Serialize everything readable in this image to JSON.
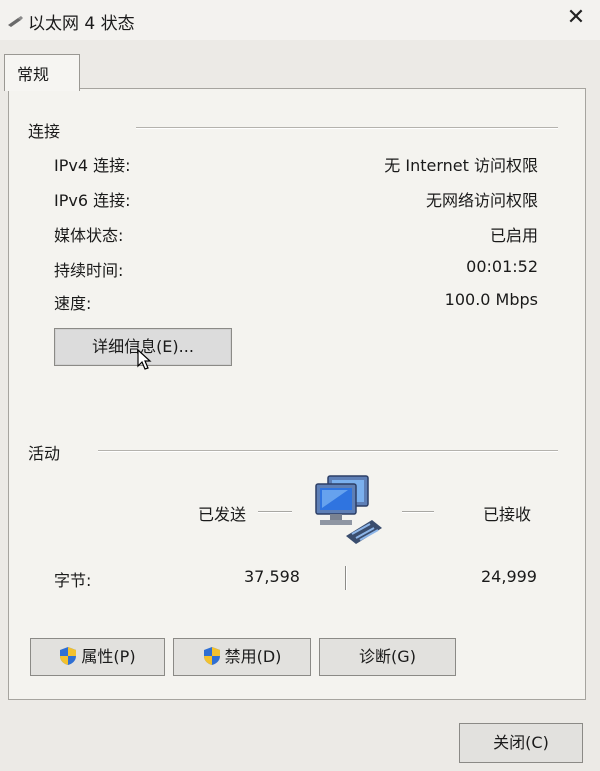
{
  "window": {
    "title": "以太网 4 状态",
    "icon": "network-adapter-icon",
    "close_glyph": "✕"
  },
  "tabs": [
    {
      "label": "常规",
      "selected": true
    }
  ],
  "connection": {
    "group_label": "连接",
    "rows": [
      {
        "label": "IPv4 连接:",
        "value": "无 Internet 访问权限"
      },
      {
        "label": "IPv6 连接:",
        "value": "无网络访问权限"
      },
      {
        "label": "媒体状态:",
        "value": "已启用"
      },
      {
        "label": "持续时间:",
        "value": "00:01:52"
      },
      {
        "label": "速度:",
        "value": "100.0 Mbps"
      }
    ],
    "details_button": "详细信息(E)..."
  },
  "activity": {
    "group_label": "活动",
    "sent_label": "已发送",
    "received_label": "已接收",
    "bytes_label": "字节:",
    "bytes_sent": "37,598",
    "bytes_received": "24,999"
  },
  "buttons": {
    "properties": "属性(P)",
    "disable": "禁用(D)",
    "diagnose": "诊断(G)",
    "close": "关闭(C)"
  },
  "colors": {
    "window_bg": "#eceae6",
    "panel_bg": "#f4f3ef",
    "button_bg": "#e2e1de",
    "shield_blue": "#2f6fd3",
    "shield_yellow": "#f2c12e"
  }
}
